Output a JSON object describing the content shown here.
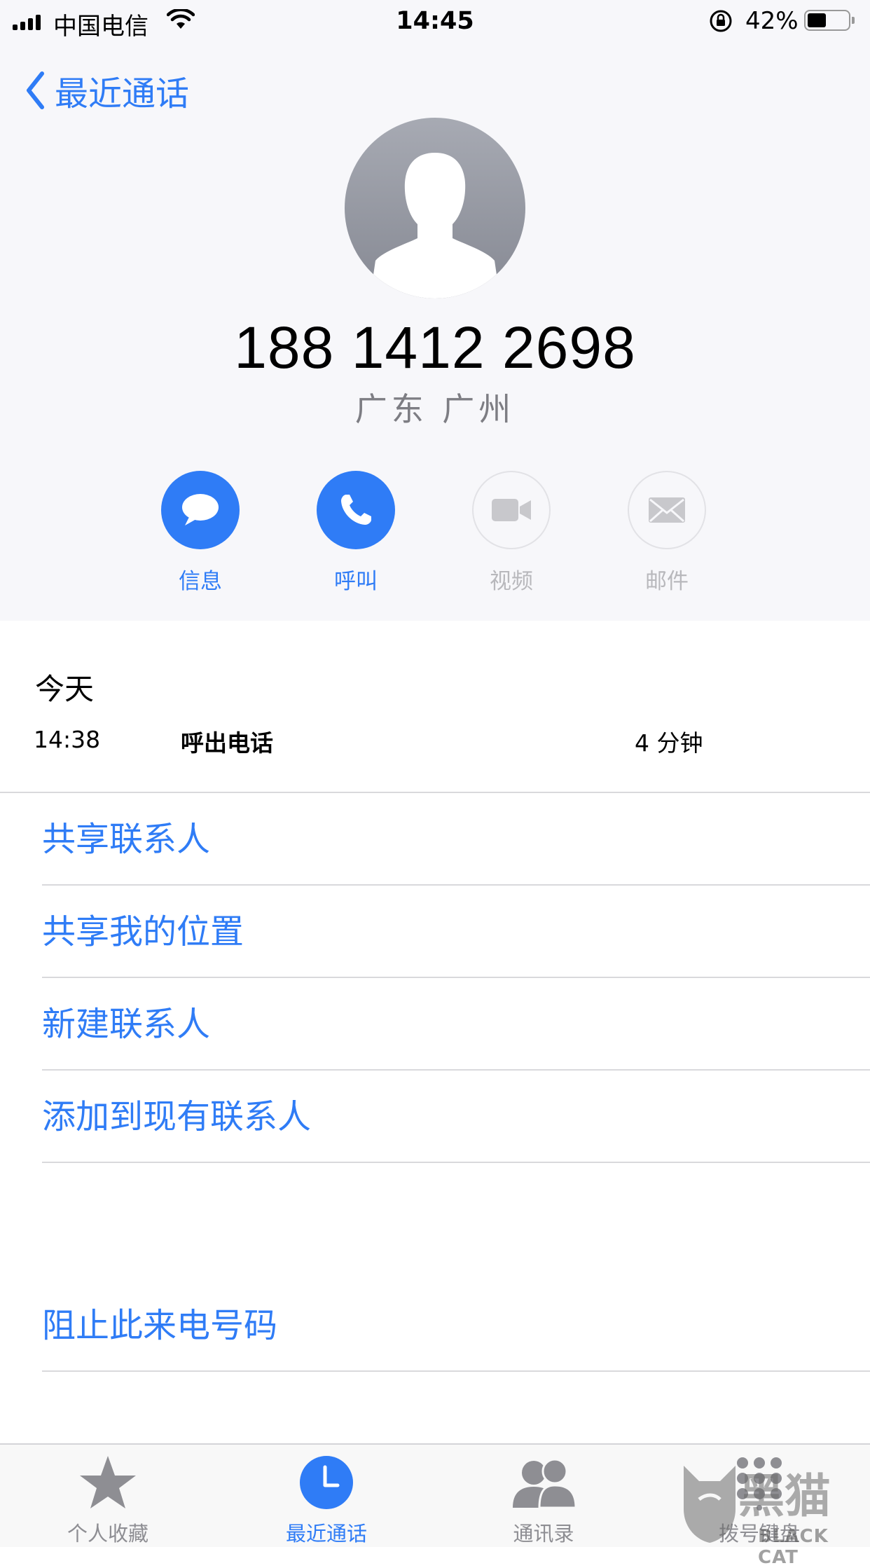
{
  "status_bar": {
    "carrier": "中国电信",
    "time": "14:45",
    "battery_percent": "42%",
    "battery_level": 0.42
  },
  "nav": {
    "back_label": "最近通话"
  },
  "contact": {
    "number": "188 1412 2698",
    "location": "广东 广州"
  },
  "actions": [
    {
      "label": "信息",
      "icon": "message-icon",
      "enabled": true
    },
    {
      "label": "呼叫",
      "icon": "phone-icon",
      "enabled": true
    },
    {
      "label": "视频",
      "icon": "video-icon",
      "enabled": false
    },
    {
      "label": "邮件",
      "icon": "mail-icon",
      "enabled": false
    }
  ],
  "history": {
    "day": "今天",
    "entries": [
      {
        "time": "14:38",
        "type": "呼出电话",
        "duration": "4 分钟"
      }
    ]
  },
  "options": [
    "共享联系人",
    "共享我的位置",
    "新建联系人",
    "添加到现有联系人",
    "阻止此来电号码"
  ],
  "tabs": [
    {
      "label": "个人收藏",
      "icon": "star-icon",
      "active": false
    },
    {
      "label": "最近通话",
      "icon": "clock-icon",
      "active": true
    },
    {
      "label": "通讯录",
      "icon": "contacts-icon",
      "active": false
    },
    {
      "label": "拨号键盘",
      "icon": "keypad-icon",
      "active": false
    }
  ],
  "watermark": {
    "cn": "黑猫",
    "en": "BLACK CAT"
  },
  "colors": {
    "accent": "#2f7cf6",
    "header_bg": "#f7f7fa",
    "disabled": "#b8b8bc"
  }
}
